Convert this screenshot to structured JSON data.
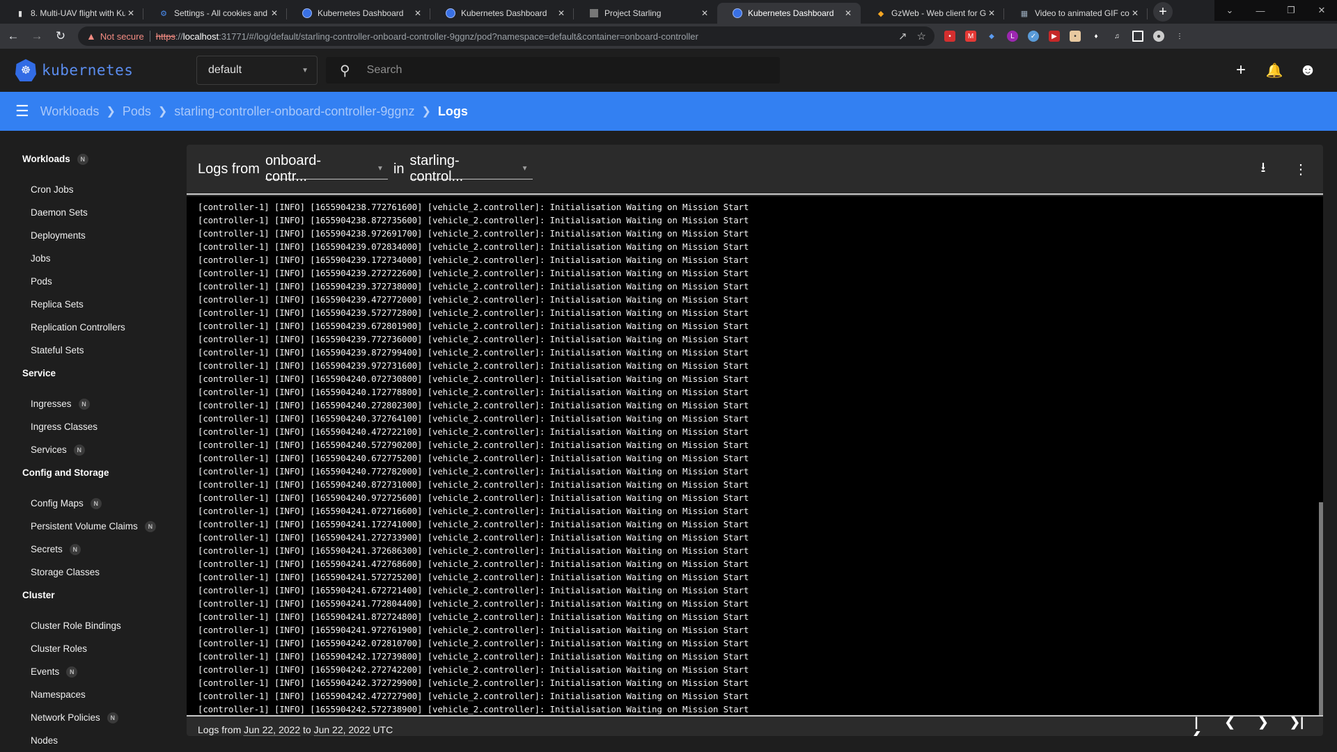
{
  "browser": {
    "tabs": [
      {
        "title": "8. Multi-UAV flight with Ku",
        "icon": "book-icon",
        "active": false
      },
      {
        "title": "Settings - All cookies and s",
        "icon": "gear-icon",
        "active": false
      },
      {
        "title": "Kubernetes Dashboard",
        "icon": "kubernetes-icon",
        "active": false
      },
      {
        "title": "Kubernetes Dashboard",
        "icon": "kubernetes-icon",
        "active": false
      },
      {
        "title": "Project Starling",
        "icon": "page-icon",
        "active": false
      },
      {
        "title": "Kubernetes Dashboard",
        "icon": "kubernetes-icon",
        "active": true
      },
      {
        "title": "GzWeb - Web client for Ga",
        "icon": "gzweb-icon",
        "active": false
      },
      {
        "title": "Video to animated GIF con",
        "icon": "gif-icon",
        "active": false
      }
    ],
    "security_label": "Not secure",
    "url": {
      "scheme": "https",
      "host": "localhost",
      "rest": ":31771/#/log/default/starling-controller-onboard-controller-9ggnz/pod?namespace=default&container=onboard-controller"
    }
  },
  "app": {
    "logo_text": "kubernetes",
    "namespace": "default",
    "search_placeholder": "Search"
  },
  "breadcrumb": [
    {
      "label": "Workloads"
    },
    {
      "label": "Pods"
    },
    {
      "label": "starling-controller-onboard-controller-9ggnz"
    },
    {
      "label": "Logs"
    }
  ],
  "sidebar": {
    "groups": [
      {
        "label": "Workloads",
        "badge": "N",
        "items": [
          {
            "label": "Cron Jobs"
          },
          {
            "label": "Daemon Sets"
          },
          {
            "label": "Deployments"
          },
          {
            "label": "Jobs"
          },
          {
            "label": "Pods"
          },
          {
            "label": "Replica Sets"
          },
          {
            "label": "Replication Controllers"
          },
          {
            "label": "Stateful Sets"
          }
        ]
      },
      {
        "label": "Service",
        "badge": null,
        "items": [
          {
            "label": "Ingresses",
            "badge": "N"
          },
          {
            "label": "Ingress Classes"
          },
          {
            "label": "Services",
            "badge": "N"
          }
        ]
      },
      {
        "label": "Config and Storage",
        "badge": null,
        "items": [
          {
            "label": "Config Maps",
            "badge": "N"
          },
          {
            "label": "Persistent Volume Claims",
            "badge": "N"
          },
          {
            "label": "Secrets",
            "badge": "N"
          },
          {
            "label": "Storage Classes"
          }
        ]
      },
      {
        "label": "Cluster",
        "badge": null,
        "items": [
          {
            "label": "Cluster Role Bindings"
          },
          {
            "label": "Cluster Roles"
          },
          {
            "label": "Events",
            "badge": "N"
          },
          {
            "label": "Namespaces"
          },
          {
            "label": "Network Policies",
            "badge": "N"
          },
          {
            "label": "Nodes"
          }
        ]
      }
    ]
  },
  "logs": {
    "header_prefix": "Logs from",
    "container_select": "onboard-contr...",
    "in_label": "in",
    "pod_select": "starling-control...",
    "line_prefix": "[controller-1] [INFO] ",
    "line_source": "[vehicle_2.controller]: ",
    "line_message": "Initialisation Waiting on Mission Start",
    "timestamps": [
      "1655904238.772761600",
      "1655904238.872735600",
      "1655904238.972691700",
      "1655904239.072834000",
      "1655904239.172734000",
      "1655904239.272722600",
      "1655904239.372738000",
      "1655904239.472772000",
      "1655904239.572772800",
      "1655904239.672801900",
      "1655904239.772736000",
      "1655904239.872799400",
      "1655904239.972731600",
      "1655904240.072730800",
      "1655904240.172778800",
      "1655904240.272802300",
      "1655904240.372764100",
      "1655904240.472722100",
      "1655904240.572790200",
      "1655904240.672775200",
      "1655904240.772782000",
      "1655904240.872731000",
      "1655904240.972725600",
      "1655904241.072716600",
      "1655904241.172741000",
      "1655904241.272733900",
      "1655904241.372686300",
      "1655904241.472768600",
      "1655904241.572725200",
      "1655904241.672721400",
      "1655904241.772804400",
      "1655904241.872724800",
      "1655904241.972761900",
      "1655904242.072810700",
      "1655904242.172739800",
      "1655904242.272742200",
      "1655904242.372729900",
      "1655904242.472727900",
      "1655904242.572738900"
    ],
    "footer": {
      "prefix": "Logs from",
      "from_date": "Jun 22, 2022",
      "to_label": "to",
      "to_date": "Jun 22, 2022",
      "tz": "UTC"
    }
  }
}
